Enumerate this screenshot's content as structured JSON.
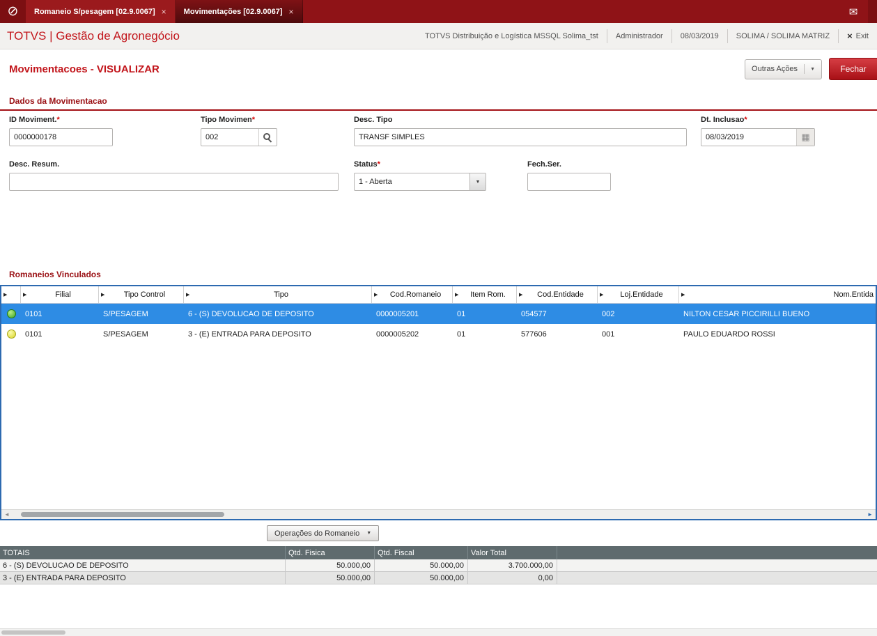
{
  "tab_bar": {
    "tabs": [
      {
        "label": "Romaneio S/pesagem [02.9.0067]",
        "close_icon": "×"
      },
      {
        "label": "Movimentações [02.9.0067]",
        "close_icon": "×"
      }
    ]
  },
  "header": {
    "app_title": "TOTVS | Gestão de Agronegócio",
    "environment": "TOTVS Distribuição e Logística MSSQL Solima_tst",
    "user": "Administrador",
    "date": "08/03/2019",
    "company": "SOLIMA / SOLIMA MATRIZ",
    "exit_icon": "×",
    "exit_label": "Exit"
  },
  "page": {
    "title": "Movimentacoes - VISUALIZAR",
    "other_actions_label": "Outras Ações",
    "close_label": "Fechar"
  },
  "form": {
    "section_title": "Dados da Movimentacao",
    "required_marker": "*",
    "fields": {
      "id_moviment": {
        "label": "ID Moviment.",
        "value": "0000000178"
      },
      "tipo_movimen": {
        "label": "Tipo Movimen",
        "value": "002"
      },
      "desc_tipo": {
        "label": "Desc. Tipo",
        "value": "TRANSF SIMPLES"
      },
      "dt_inclusao": {
        "label": "Dt. Inclusao",
        "value": "08/03/2019"
      },
      "desc_resum": {
        "label": "Desc. Resum.",
        "value": ""
      },
      "status": {
        "label": "Status",
        "value": "1 - Aberta"
      },
      "fech_ser": {
        "label": "Fech.Ser.",
        "value": ""
      }
    }
  },
  "grid": {
    "section_title": "Romaneios Vinculados",
    "column_marker_icon": "▶",
    "columns": [
      "Filial",
      "Tipo Control",
      "Tipo",
      "Cod.Romaneio",
      "Item Rom.",
      "Cod.Entidade",
      "Loj.Entidade",
      "Nom.Entida"
    ],
    "rows": [
      {
        "status": "green",
        "selected": true,
        "filial": "0101",
        "tipo_control": "S/PESAGEM",
        "tipo": "6 - (S) DEVOLUCAO DE DEPOSITO",
        "cod_romaneio": "0000005201",
        "item_rom": "01",
        "cod_entidade": "054577",
        "loj_entidade": "002",
        "nom_entidade": "NILTON CESAR PICCIRILLI BUENO"
      },
      {
        "status": "yellow",
        "selected": false,
        "filial": "0101",
        "tipo_control": "S/PESAGEM",
        "tipo": "3 - (E) ENTRADA PARA DEPOSITO",
        "cod_romaneio": "0000005202",
        "item_rom": "01",
        "cod_entidade": "577606",
        "loj_entidade": "001",
        "nom_entidade": "PAULO EDUARDO ROSSI"
      }
    ],
    "operations_button_label": "Operações do Romaneio"
  },
  "totals": {
    "columns": [
      "TOTAIS",
      "Qtd. Fisica",
      "Qtd. Fiscal",
      "Valor Total"
    ],
    "rows": [
      {
        "label": "6 - (S) DEVOLUCAO DE DEPOSITO",
        "qtd_fisica": "50.000,00",
        "qtd_fiscal": "50.000,00",
        "valor_total": "3.700.000,00"
      },
      {
        "label": "3 - (E) ENTRADA PARA DEPOSITO",
        "qtd_fisica": "50.000,00",
        "qtd_fiscal": "50.000,00",
        "valor_total": "0,00"
      }
    ]
  },
  "icons": {
    "logo": "⊘",
    "mail": "✉",
    "calendar": "▦",
    "dropdown": "▼",
    "scroll_left": "◄",
    "scroll_right": "►"
  },
  "colors": {
    "topbar": "#8f1317",
    "topbar_active_tab": "#4e0a0c",
    "accent_red": "#c2151b",
    "section_red": "#9a1014",
    "close_button_red": "#a81016",
    "selection_blue": "#2e8ce4",
    "grid_border_blue": "#2d6ab0",
    "totals_header_gray": "#5f6b6e",
    "status_green": "#3aa224",
    "status_yellow": "#d9d526"
  }
}
